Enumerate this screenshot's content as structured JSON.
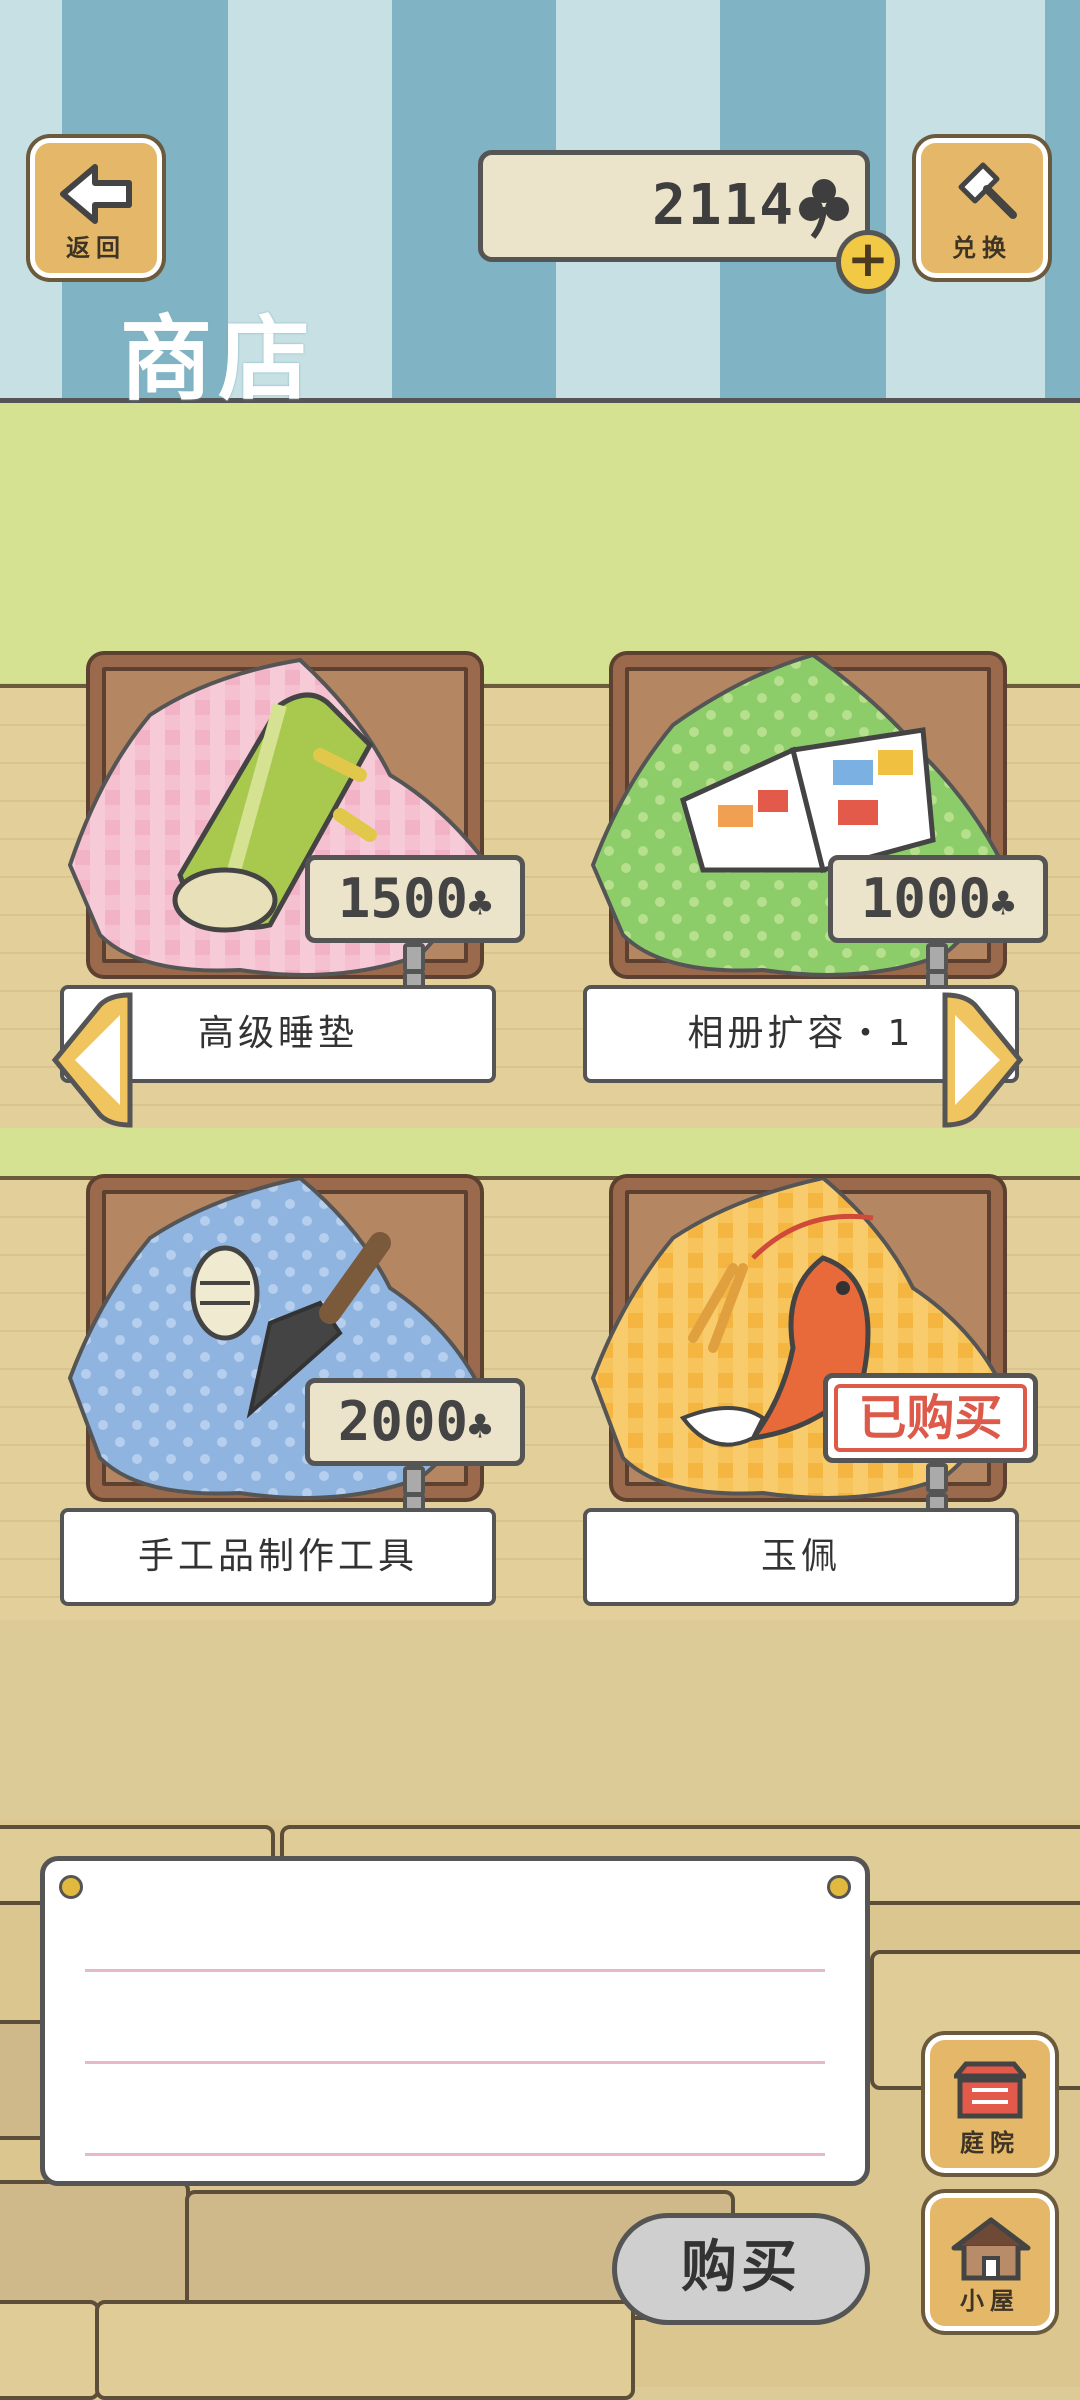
{
  "header": {
    "back_label": "返回",
    "exchange_label": "兑换",
    "title": "商店",
    "coins": "2114"
  },
  "items": [
    {
      "name": "高级睡垫",
      "price": "1500",
      "cloth": "pink-gingham",
      "icon": "sleeping-mat-icon",
      "sold": false
    },
    {
      "name": "相册扩容・1",
      "price": "1000",
      "cloth": "green-dots",
      "icon": "album-icon",
      "sold": false
    },
    {
      "name": "手工品制作工具",
      "price": "2000",
      "cloth": "blue-dots",
      "icon": "craft-tools-icon",
      "sold": false
    },
    {
      "name": "玉佩",
      "price": "",
      "cloth": "yellow-gingham",
      "icon": "jade-koi-pendant-icon",
      "sold": true,
      "sold_label": "已购买"
    }
  ],
  "nav": {
    "yard_label": "庭院",
    "house_label": "小屋"
  },
  "buy_label": "购买",
  "currency_icon": "clover-icon",
  "colors": {
    "accent": "#e4b868",
    "sold": "#dd5a4a",
    "wall": "#d4e292",
    "stripe": "#80b3c3"
  }
}
